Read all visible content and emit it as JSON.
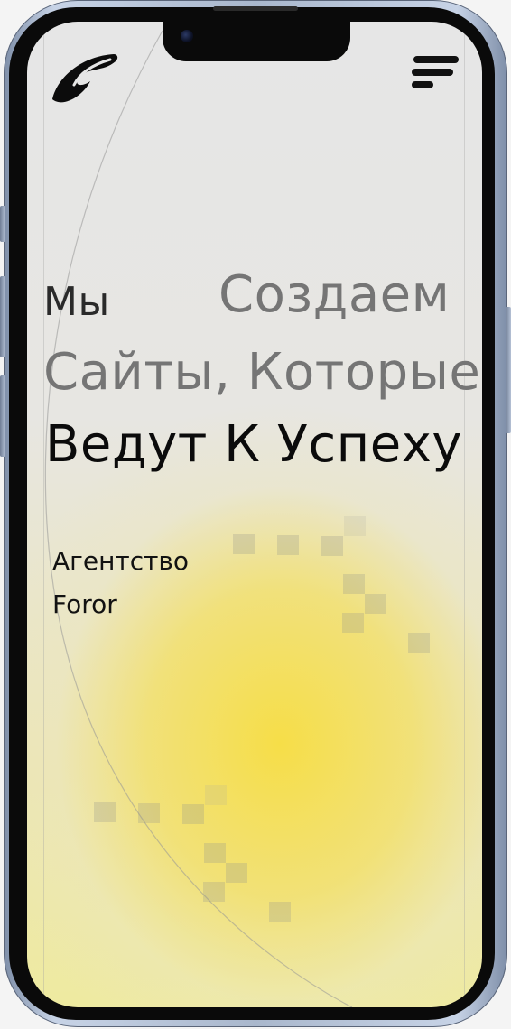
{
  "header": {
    "logo_icon": "swoosh-logo-icon",
    "menu_icon": "hamburger-menu-icon"
  },
  "hero": {
    "line1_word1": "Мы",
    "line1_word2": "Создаем",
    "line2": "Сайты, Которые",
    "line3": "Ведут К Успеху"
  },
  "subtitle": {
    "line1": "Агентство",
    "line2": "Foror"
  },
  "colors": {
    "accent": "#f6de48",
    "muted_text": "#757575",
    "dark_text": "#0b0b0b"
  }
}
